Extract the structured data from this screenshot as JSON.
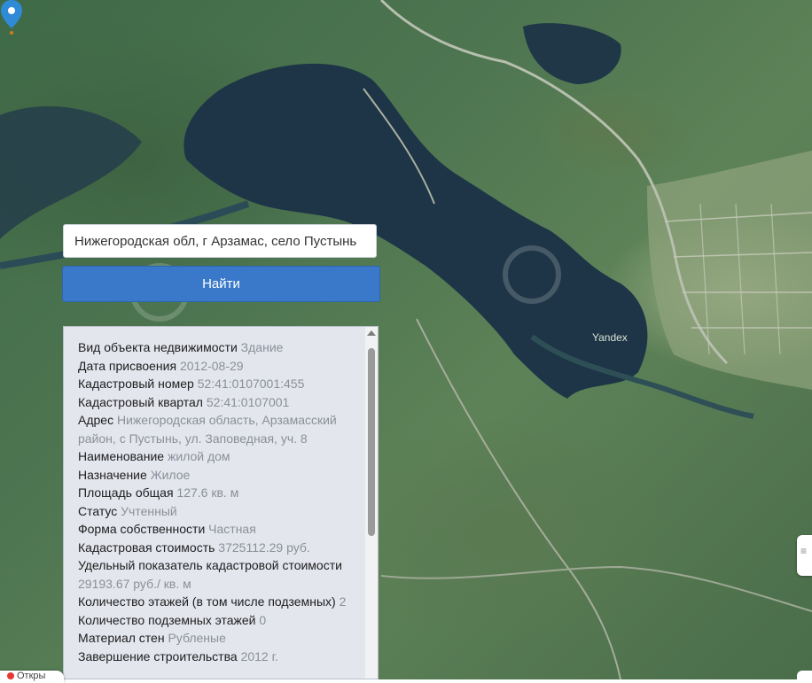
{
  "search": {
    "value": "Нижегородская обл, г Арзамас, село Пустынь"
  },
  "find_button_label": "Найти",
  "map": {
    "watermark": "Yandex"
  },
  "info": [
    {
      "label": "Вид объекта недвижимости",
      "value": "Здание"
    },
    {
      "label": "Дата присвоения",
      "value": "2012-08-29"
    },
    {
      "label": "Кадастровый номер",
      "value": "52:41:0107001:455"
    },
    {
      "label": "Кадастровый квартал",
      "value": "52:41:0107001"
    },
    {
      "label": "Адрес",
      "value": "Нижегородская область, Арзамасский район, с Пустынь, ул. Заповедная, уч. 8"
    },
    {
      "label": "Наименование",
      "value": "жилой дом"
    },
    {
      "label": "Назначение",
      "value": "Жилое"
    },
    {
      "label": "Площадь общая",
      "value": "127.6 кв. м"
    },
    {
      "label": "Статус",
      "value": "Учтенный"
    },
    {
      "label": "Форма собственности",
      "value": "Частная"
    },
    {
      "label": "Кадастровая стоимость",
      "value": "3725112.29 руб."
    },
    {
      "label": "Удельный показатель кадастровой стоимости",
      "value": "29193.67 руб./ кв. м"
    },
    {
      "label": "Количество этажей (в том числе подземных)",
      "value": "2"
    },
    {
      "label": "Количество подземных этажей",
      "value": "0"
    },
    {
      "label": "Материал стен",
      "value": "Рубленые"
    },
    {
      "label": "Завершение строительства",
      "value": "2012 г."
    }
  ],
  "bottom_chip_text": "Откры",
  "colors": {
    "button": "#3a79c9",
    "pin": "#2f8bd6",
    "panel_bg": "#e4e6ee",
    "value_text": "#8a8f98"
  }
}
